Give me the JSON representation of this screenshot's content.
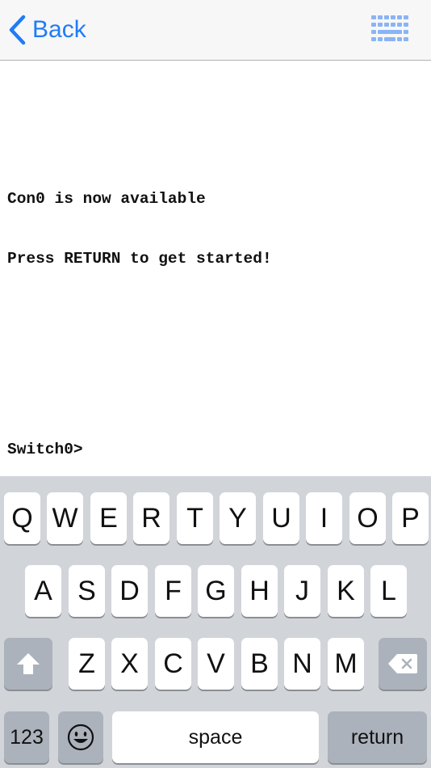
{
  "navbar": {
    "back_label": "Back",
    "accent_color": "#1f7cf6",
    "right_icon": "keyboard-icon"
  },
  "terminal": {
    "lines": [
      "Con0 is now available",
      "Press RETURN to get started!",
      "Switch0>"
    ]
  },
  "keyboard": {
    "row1": [
      "Q",
      "W",
      "E",
      "R",
      "T",
      "Y",
      "U",
      "I",
      "O",
      "P"
    ],
    "row2": [
      "A",
      "S",
      "D",
      "F",
      "G",
      "H",
      "J",
      "K",
      "L"
    ],
    "row3": [
      "Z",
      "X",
      "C",
      "V",
      "B",
      "N",
      "M"
    ],
    "shift_icon": "shift-icon",
    "delete_icon": "backspace-icon",
    "emoji_icon": "emoji-icon",
    "numbers_label": "123",
    "space_label": "space",
    "return_label": "return"
  }
}
